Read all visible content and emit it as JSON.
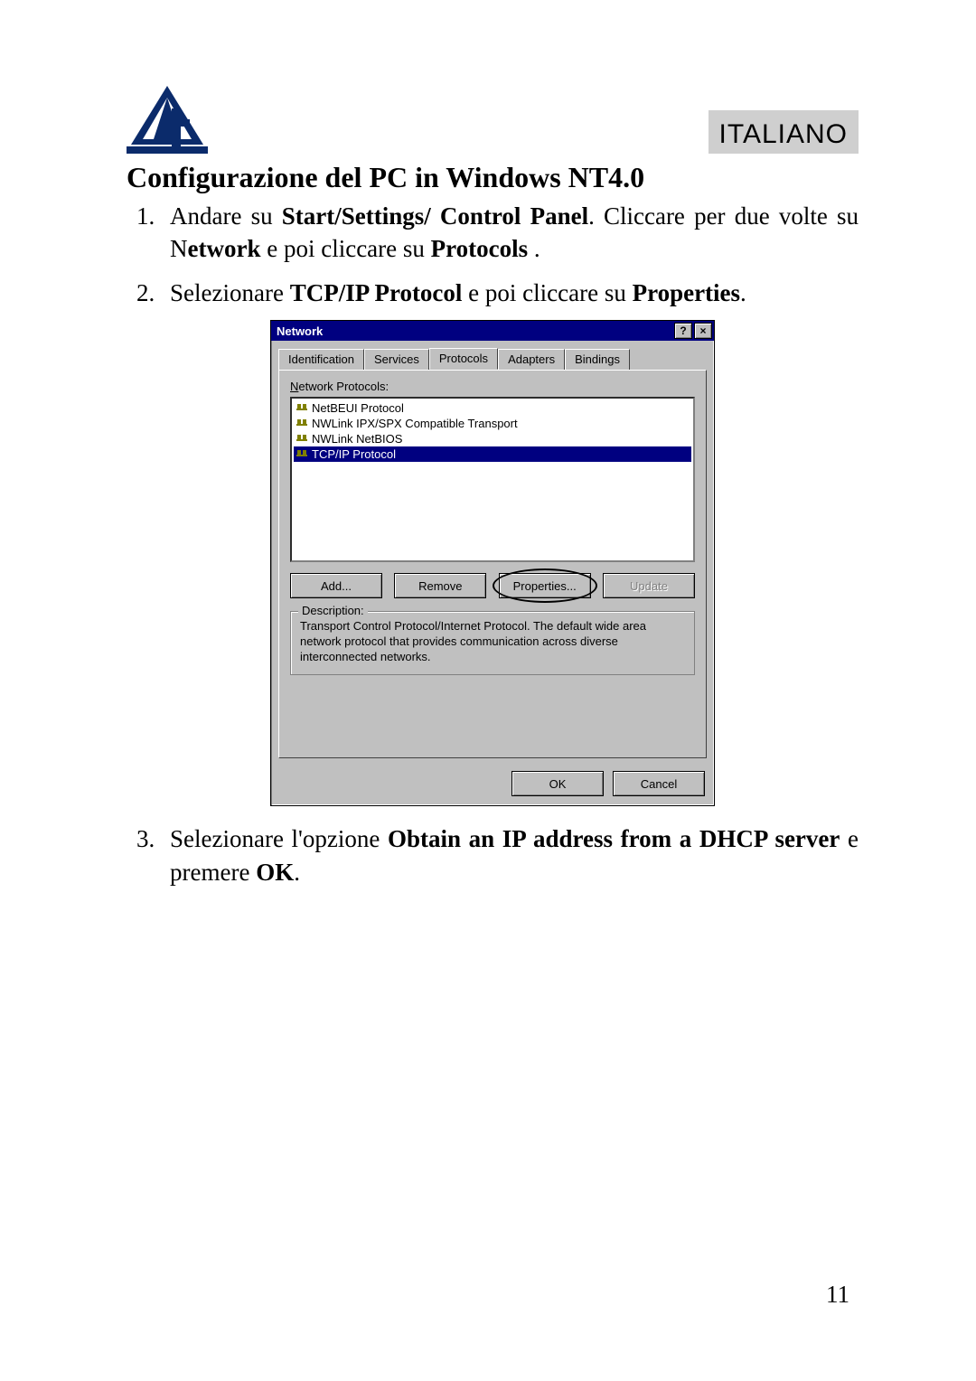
{
  "header": {
    "language": "ITALIANO"
  },
  "section_title": "Configurazione del PC in Windows NT4.0",
  "instructions": {
    "item1": {
      "pre": "Andare su  ",
      "bold1": "Start/Settings/ Control Panel",
      "mid1": ". Cliccare per  due volte su N",
      "bold2": "etwork",
      "mid2": " e poi cliccare su ",
      "bold3": "Protocols",
      "post": " ."
    },
    "item2": {
      "pre": "Selezionare ",
      "bold1": "TCP/IP Protocol",
      "mid1": " e poi cliccare su  ",
      "bold2": "Properties",
      "post": "."
    },
    "item3": {
      "pre": "Selezionare l'opzione ",
      "bold1": "Obtain an IP address from a DHCP server",
      "mid1": " e premere ",
      "bold2": "OK",
      "post": "."
    }
  },
  "dialog": {
    "title": "Network",
    "help_glyph": "?",
    "close_glyph": "×",
    "tabs": [
      "Identification",
      "Services",
      "Protocols",
      "Adapters",
      "Bindings"
    ],
    "active_tab_index": 2,
    "list_label": "Network Protocols:",
    "protocols": [
      {
        "name": "NetBEUI Protocol",
        "selected": false
      },
      {
        "name": "NWLink IPX/SPX Compatible Transport",
        "selected": false
      },
      {
        "name": "NWLink NetBIOS",
        "selected": false
      },
      {
        "name": "TCP/IP Protocol",
        "selected": true
      }
    ],
    "buttons": {
      "add": "Add...",
      "remove": "Remove",
      "properties": "Properties...",
      "update": "Update"
    },
    "description_label": "Description:",
    "description_text": "Transport Control Protocol/Internet Protocol. The default wide area network protocol that provides communication across diverse interconnected networks.",
    "ok": "OK",
    "cancel": "Cancel"
  },
  "page_number": "11"
}
